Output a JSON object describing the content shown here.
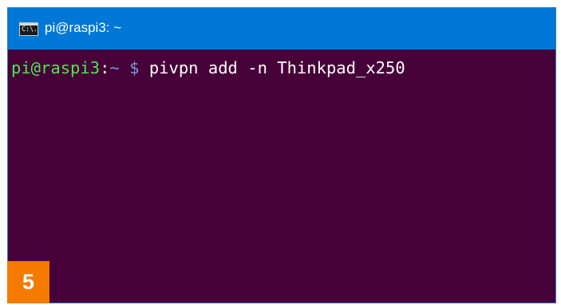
{
  "window": {
    "title": "pi@raspi3: ~",
    "icon": "cmd-icon",
    "icon_glyph": "C:\\."
  },
  "terminal": {
    "prompt_user": "pi@raspi3",
    "prompt_colon": ":",
    "prompt_path": "~",
    "prompt_dollar": "$",
    "command": "pivpn add -n Thinkpad_x250"
  },
  "badge": {
    "label": "5"
  },
  "colors": {
    "titlebar": "#0078d7",
    "terminal_bg": "#470139",
    "prompt_user": "#4ee64e",
    "prompt_path": "#6b9bd8",
    "badge": "#f47a00"
  }
}
